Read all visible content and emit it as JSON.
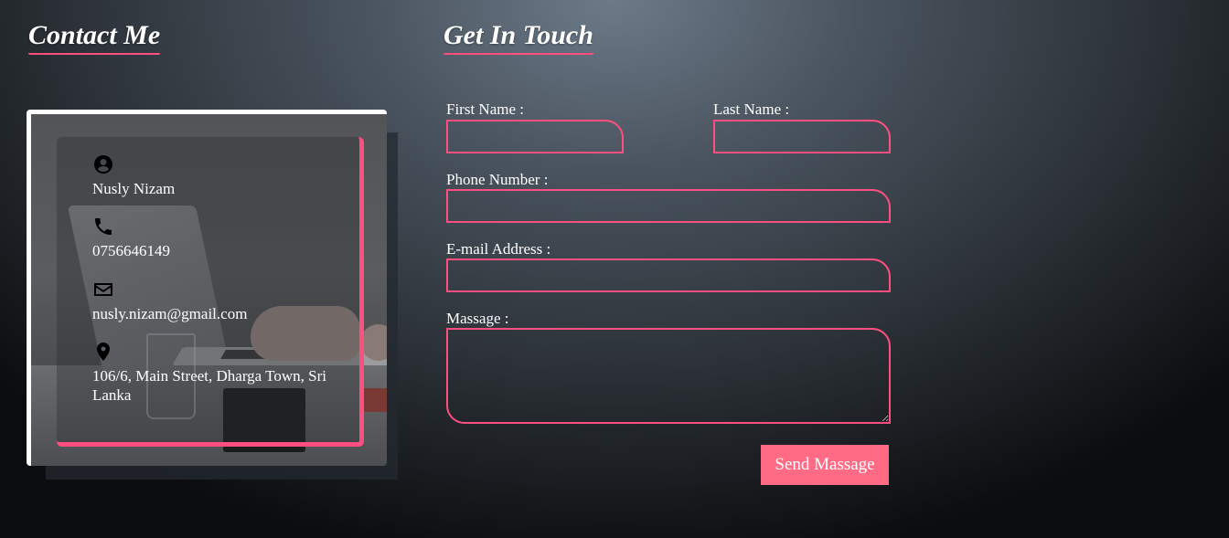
{
  "contact": {
    "heading": "Contact Me",
    "name": "Nusly Nizam",
    "phone": "0756646149",
    "email": "nusly.nizam@gmail.com",
    "address": "106/6, Main Street, Dharga Town, Sri Lanka",
    "icons": [
      "user-circle-icon",
      "phone-icon",
      "envelope-icon",
      "map-pin-icon"
    ]
  },
  "form": {
    "heading": "Get In Touch",
    "first_name_label": "First Name :",
    "last_name_label": "Last Name :",
    "phone_label": "Phone Number :",
    "email_label": "E-mail Address :",
    "message_label": "Massage :",
    "first_name_value": "",
    "last_name_value": "",
    "phone_value": "",
    "email_value": "",
    "message_value": "",
    "submit_label": "Send Massage"
  },
  "colors": {
    "accent": "#ff4f80",
    "button": "#ff6b84",
    "text": "#ffffff"
  }
}
